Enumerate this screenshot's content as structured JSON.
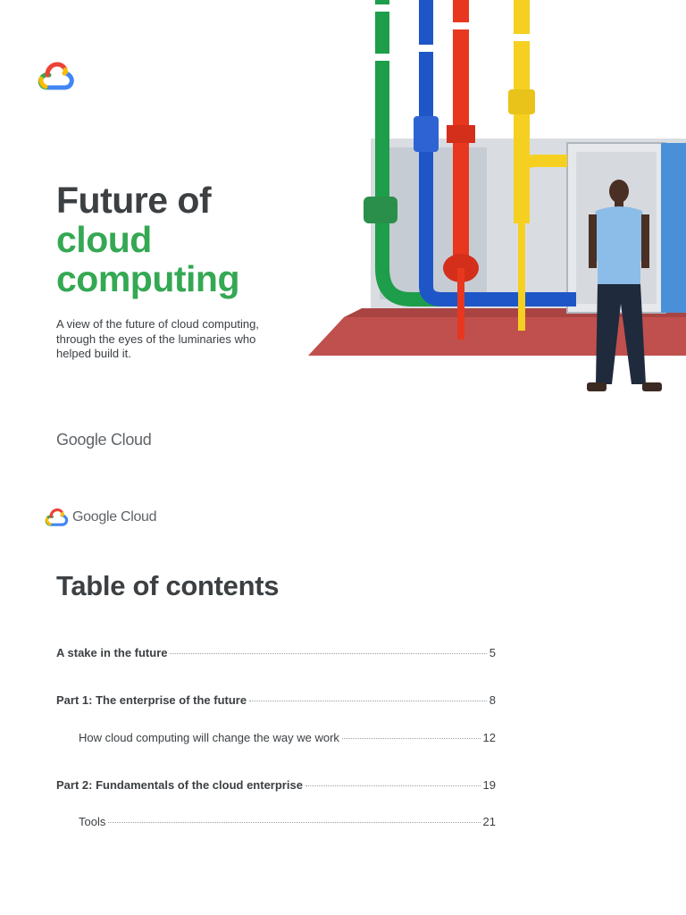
{
  "cover": {
    "title_line1": "Future of",
    "title_line2": "cloud",
    "title_line3": "computing",
    "subtitle": "A view of the future of cloud computing, through the eyes of the luminaries who helped build it.",
    "brand": "Google Cloud"
  },
  "header2": {
    "brand": "Google Cloud"
  },
  "toc": {
    "title": "Table of contents",
    "items": [
      {
        "label": "A stake in the future",
        "page": "5"
      },
      {
        "label": "Part 1: The enterprise of the future",
        "page": "8"
      },
      {
        "label": "How cloud computing will change the way we work",
        "page": "12"
      },
      {
        "label": "Part 2: Fundamentals of the cloud enterprise",
        "page": "19"
      },
      {
        "label": "Tools",
        "page": "21"
      }
    ]
  },
  "colors": {
    "green": "#34a853",
    "blue": "#4285f4",
    "red": "#ea4335",
    "yellow": "#fbbc04",
    "text": "#3c4043"
  }
}
